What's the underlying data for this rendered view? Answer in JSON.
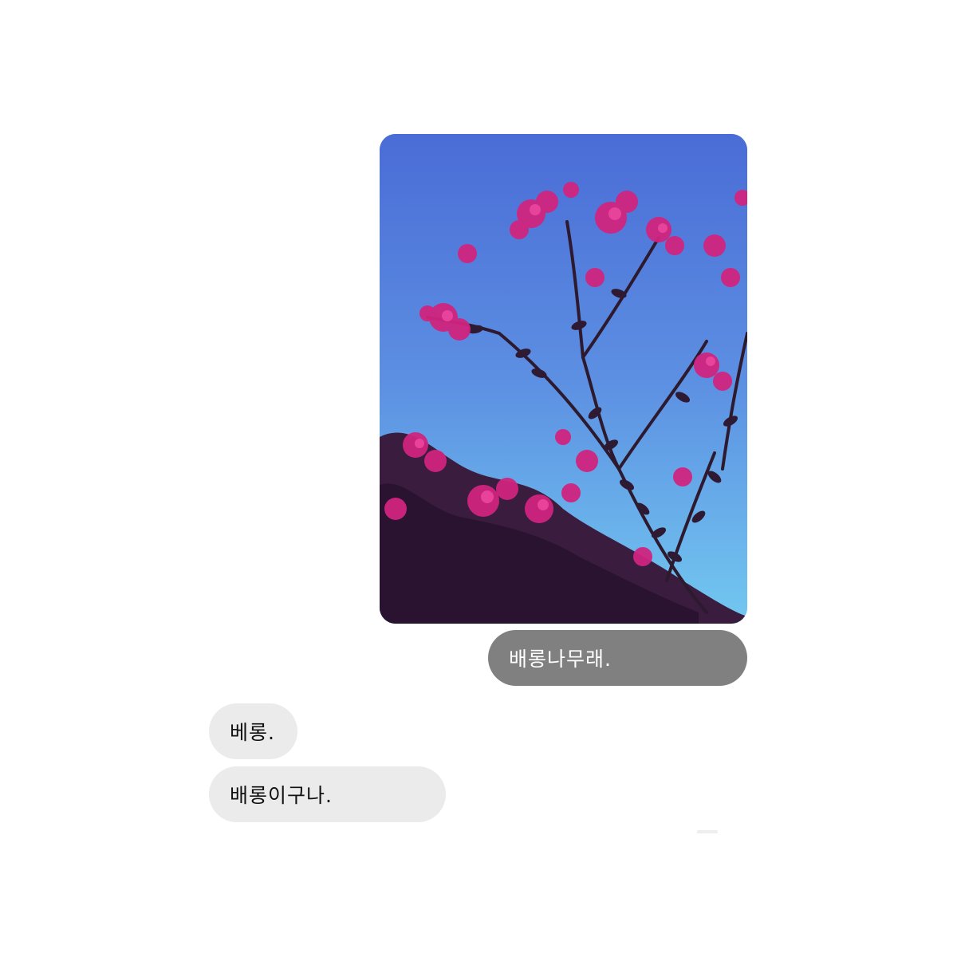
{
  "messages": {
    "sent": {
      "photo": {
        "icon": "crape-myrtle-photo",
        "sky_colors": [
          "#4d72d9",
          "#5d90e3",
          "#6cc2ef"
        ],
        "flower_color": "#d0247f",
        "foliage_color": "#3a1f3f"
      },
      "text": "배롱나무래."
    },
    "received": [
      {
        "text": "베롱."
      },
      {
        "text": "배롱이구나."
      }
    ]
  },
  "colors": {
    "background": "#ffffff",
    "sent_bubble": "#808080",
    "sent_text": "#ffffff",
    "received_bubble": "#ebebeb",
    "received_text": "#111111"
  }
}
